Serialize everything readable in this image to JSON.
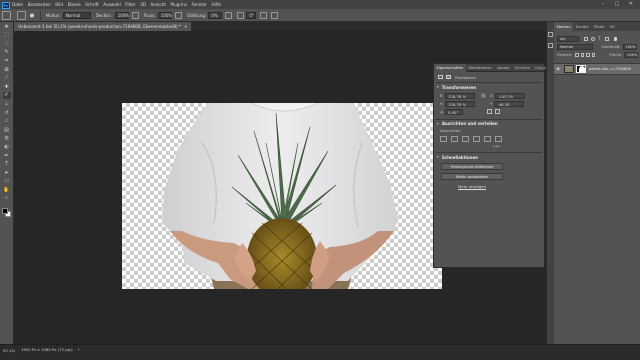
{
  "menubar": {
    "logo": "Ps",
    "items": [
      "Datei",
      "Bearbeiten",
      "Bild",
      "Ebene",
      "Schrift",
      "Auswahl",
      "Filter",
      "3D",
      "Ansicht",
      "Plug-ins",
      "Fenster",
      "Hilfe"
    ],
    "window_controls": {
      "minimize": "–",
      "restore": "□",
      "close": "✕"
    }
  },
  "options_bar": {
    "mode_label": "Modus:",
    "mode_value": "Normal",
    "opacity_label": "Deckkr.:",
    "opacity_value": "100%",
    "flow_label": "Fluss:",
    "flow_value": "100%",
    "smoothing_label": "Glättung:",
    "smoothing_value": "0%",
    "angle_value": "0°"
  },
  "document": {
    "tab_label": "Unbenannt-1 bei 50,1% (pexels-shvets-production-7194808, Ebenenmaske/8) *",
    "tab_close": "×"
  },
  "toolbox": {
    "tools": [
      "move-tool-icon",
      "marquee-tool-icon",
      "lasso-tool-icon",
      "quick-select-tool-icon",
      "crop-tool-icon",
      "frame-tool-icon",
      "eyedropper-tool-icon",
      "healing-tool-icon",
      "brush-tool-icon",
      "stamp-tool-icon",
      "history-brush-icon",
      "eraser-tool-icon",
      "gradient-tool-icon",
      "blur-tool-icon",
      "dodge-tool-icon",
      "pen-tool-icon",
      "type-tool-icon",
      "path-select-tool-icon",
      "shape-tool-icon",
      "hand-tool-icon",
      "zoom-tool-icon"
    ],
    "active_tool": "brush-tool-icon",
    "foreground_color": "#000000",
    "background_color": "#ffffff"
  },
  "properties_panel": {
    "tabs": [
      "Eigenschaften",
      "Bibliotheken",
      "Absatz",
      "Zeichen",
      "Glyphen"
    ],
    "active_tab": "Eigenschaften",
    "type_label": "Pixelebene",
    "transform": {
      "title": "Transformieren",
      "w_label": "B",
      "w_value": "128,78 %",
      "x_label": "X",
      "x_value": "-145,79",
      "h_label": "H",
      "h_value": "128,78 %",
      "y_label": "Y",
      "y_value": "-46,30",
      "angle_value": "0,00°"
    },
    "align": {
      "title": "Ausrichten und verteilen",
      "subtitle": "Ausrichten:",
      "more": "•••"
    },
    "quick_actions": {
      "title": "Schnellaktionen",
      "remove_bg": "Hintergrund entfernen",
      "select_subject": "Motiv auswählen",
      "more_link": "Mehr anzeigen"
    }
  },
  "right_panel": {
    "tabs": [
      "Ebenen",
      "Kanäle",
      "Pfade",
      "3D"
    ],
    "active_tab": "Ebenen",
    "filter_label": "Art",
    "blend_mode": "Normal",
    "opacity_label": "Deckkraft:",
    "opacity_value": "100%",
    "lock_label": "Fixieren:",
    "fill_label": "Fläche:",
    "fill_value": "100%",
    "layers": [
      {
        "name": "pexels-shv...n-7194808",
        "visible": true
      }
    ]
  },
  "statusbar": {
    "zoom": "50,1%",
    "info": "1920 Px x 1080 Px (72 ppi)",
    "arrow": "›"
  },
  "colors": {
    "app_bg": "#535353",
    "menubar_bg": "#434343",
    "pasteboard": "#262626",
    "accent": "#31a8ff"
  }
}
